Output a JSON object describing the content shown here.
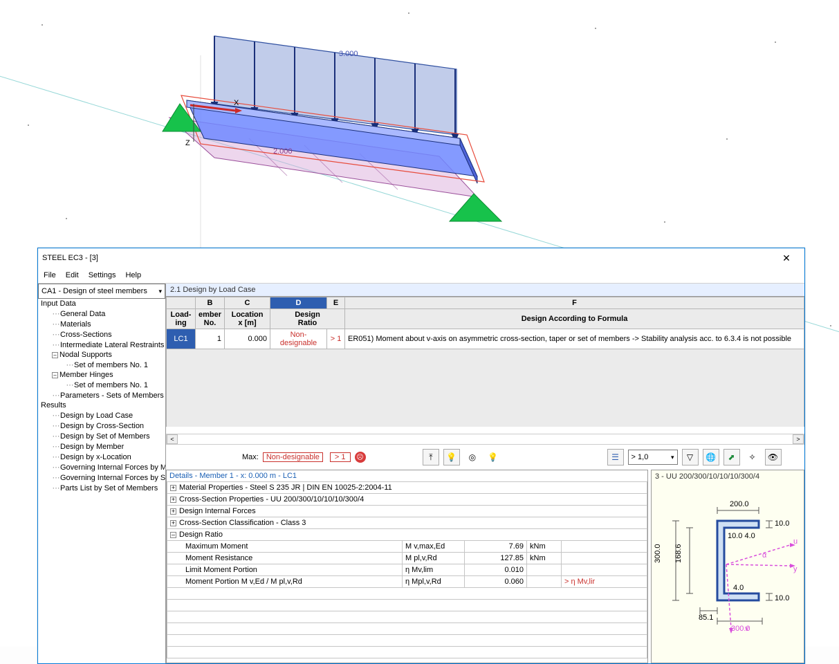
{
  "viewport": {
    "load_arrows_label": "3.000",
    "surface_label": "2.000"
  },
  "window": {
    "title": "STEEL EC3 - [3]",
    "menu": {
      "file": "File",
      "edit": "Edit",
      "settings": "Settings",
      "help": "Help"
    },
    "combo": "CA1 - Design of steel members",
    "tree": {
      "input": "Input Data",
      "general": "General Data",
      "materials": "Materials",
      "cross": "Cross-Sections",
      "intermediate": "Intermediate Lateral Restraints",
      "nodal": "Nodal Supports",
      "nodal_set": "Set of members No. 1",
      "hinges": "Member Hinges",
      "hinges_set": "Set of members No. 1",
      "params": "Parameters - Sets of Members",
      "results": "Results",
      "r1": "Design by Load Case",
      "r2": "Design by Cross-Section",
      "r3": "Design by Set of Members",
      "r4": "Design by Member",
      "r5": "Design by x-Location",
      "r6": "Governing Internal Forces by M",
      "r7": "Governing Internal Forces by S",
      "r8": "Parts List by Set of Members"
    },
    "section_title": "2.1 Design by Load Case",
    "table": {
      "col_B": "B",
      "col_C": "C",
      "col_D": "D",
      "col_E": "E",
      "col_F": "F",
      "h_loading": "Load-\ning",
      "h_member": "ember\nNo.",
      "h_location": "Location\nx [m]",
      "h_design": "Design\nRatio",
      "h_formula": "Design According to Formula",
      "row": {
        "loading": "LC1",
        "member": "1",
        "location": "0.000",
        "ratio": "Non-designable",
        "gt1": "> 1",
        "formula": "ER051) Moment about v-axis on asymmetric cross-section, taper or set of members -> Stability analysis acc. to 6.3.4 is not possible"
      }
    },
    "toolbar": {
      "max_label": "Max:",
      "max_value": "Non-designable",
      "gt1": "> 1",
      "ratio_combo": "> 1,0"
    },
    "details": {
      "title": "Details - Member 1 - x: 0.000 m - LC1",
      "mat": "Material Properties - Steel S 235 JR | DIN EN 10025-2:2004-11",
      "cs": "Cross-Section Properties  -  UU 200/300/10/10/10/300/4",
      "dif": "Design Internal Forces",
      "csc": "Cross-Section Classification - Class 3",
      "dr": "Design Ratio",
      "rows": [
        {
          "label": "Maximum Moment",
          "sym": "M v,max,Ed",
          "val": "7.69",
          "unit": "kNm",
          "flag": ""
        },
        {
          "label": "Moment Resistance",
          "sym": "M pl,v,Rd",
          "val": "127.85",
          "unit": "kNm",
          "flag": ""
        },
        {
          "label": "Limit Moment Portion",
          "sym": "η Mv,lim",
          "val": "0.010",
          "unit": "",
          "flag": ""
        },
        {
          "label": "Moment Portion M v,Ed / M pl,v,Rd",
          "sym": "η Mpl,v,Rd",
          "val": "0.060",
          "unit": "",
          "flag": "> η Mv,lir"
        }
      ]
    },
    "section": {
      "title": "3 - UU 200/300/10/10/10/300/4",
      "dims": {
        "w": "200.0",
        "h": "300.0",
        "inner": "168.6",
        "bot": "300.0",
        "offset": "85.1",
        "t1": "10.0",
        "t2": "10.0",
        "t3": "10.0 4.0",
        "t4": "4.0"
      }
    }
  }
}
